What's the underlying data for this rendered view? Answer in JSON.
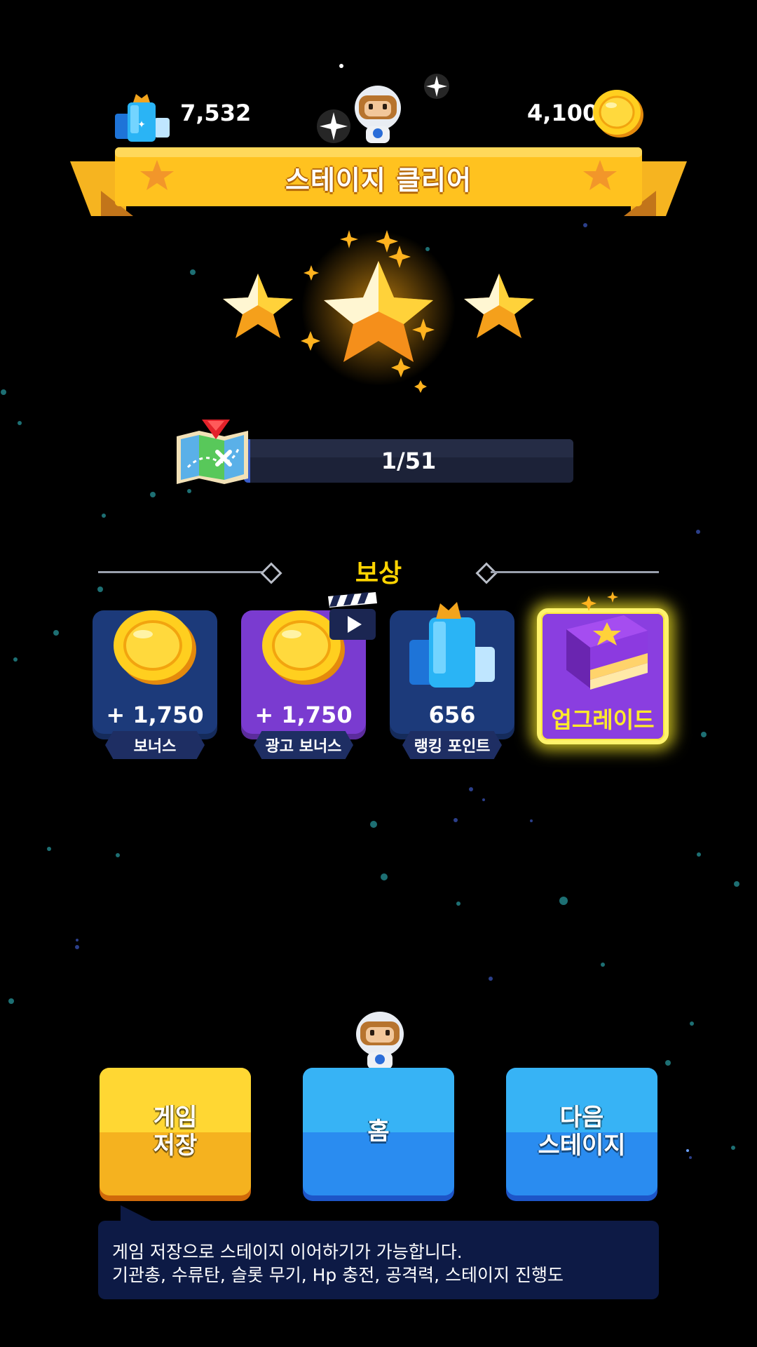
{
  "top_bar": {
    "ranking_points": "7,532",
    "coins": "4,100"
  },
  "banner": {
    "title": "스테이지 클리어"
  },
  "stars": {
    "earned": 3,
    "total": 3
  },
  "progress": {
    "text": "1/51",
    "current": 1,
    "total": 51
  },
  "rewards": {
    "title": "보상",
    "items": [
      {
        "value": "+ 1,750",
        "label": "보너스",
        "icon": "coin-icon"
      },
      {
        "value": "+ 1,750",
        "label": "광고 보너스",
        "icon": "coin-icon"
      },
      {
        "value": "656",
        "label": "랭킹 포인트",
        "icon": "crystal-icon"
      },
      {
        "value": "업그레이드",
        "icon": "book-icon"
      }
    ]
  },
  "buttons": {
    "save": "게임\n저장",
    "home": "홈",
    "next": "다음\n스테이지"
  },
  "tip": {
    "line1": "게임 저장으로 스테이지 이어하기가 가능합니다.",
    "line2": "기관총, 수류탄, 슬롯 무기, Hp 충전, 공격력, 스테이지 진행도"
  },
  "colors": {
    "banner": "#ffc21f",
    "button_yellow": "#ffd733",
    "button_blue": "#37b3f5",
    "reward_title": "#ffd400",
    "upgrade_text": "#ffea2a"
  }
}
